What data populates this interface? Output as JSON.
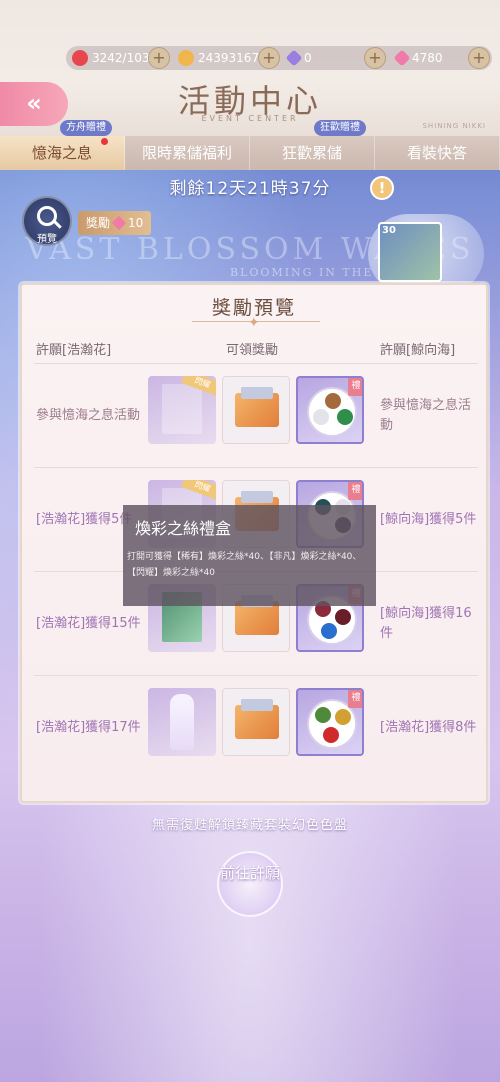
{
  "header": {
    "title": "活動中心",
    "subtitle": "EVENT CENTER",
    "corner_text": "SHINING NIKKI"
  },
  "resources": {
    "stamina": "3242/103",
    "gold": "24393167",
    "diamond": "0",
    "pink_diamond": "4780"
  },
  "tabs": [
    {
      "label": "憶海之息",
      "badge": "方舟贈禮",
      "active": true
    },
    {
      "label": "限時累儲福利",
      "badge": ""
    },
    {
      "label": "狂歡累儲",
      "badge": "狂歡贈禮"
    },
    {
      "label": "看裝快答",
      "badge": ""
    }
  ],
  "countdown": "剩餘12天21時37分",
  "info_icon": "!",
  "preview": {
    "label": "預覽",
    "reward_label": "獎勵",
    "reward_cost": "10"
  },
  "background": {
    "title": "VAST BLOSSOM WAVES",
    "subtitle": "BLOOMING IN THE WAVES"
  },
  "deco": {
    "number": "30"
  },
  "modal": {
    "title": "獎勵預覽",
    "col_left": "許願[浩瀚花]",
    "col_mid": "可領獎勵",
    "col_right": "許願[鯨向海]",
    "rows": [
      {
        "left": "參與憶海之息活動",
        "right": "參與憶海之息活動"
      },
      {
        "left": "[浩瀚花]獲得5件",
        "right": "[鯨向海]獲得5件"
      },
      {
        "left": "[浩瀚花]獲得15件",
        "right": "[鯨向海]獲得16件"
      },
      {
        "left": "[浩瀚花]獲得17件",
        "right": "[浩瀚花]獲得8件"
      }
    ],
    "tag_label": "禮",
    "ribbon_label": "閃耀"
  },
  "tooltip": {
    "title": "煥彩之絲禮盒",
    "description": "打開可獲得【稀有】煥彩之絲*40、【非凡】煥彩之絲*40、【閃耀】煥彩之絲*40"
  },
  "bottom": {
    "caption": "無需復甦解鎖臻藏套裝幻色色盤",
    "wish_button": "前往許願"
  },
  "colors": {
    "accent_pink": "#f08aa6",
    "tab_active": "#f6e3c6",
    "badge_blue": "#6f79c9"
  }
}
